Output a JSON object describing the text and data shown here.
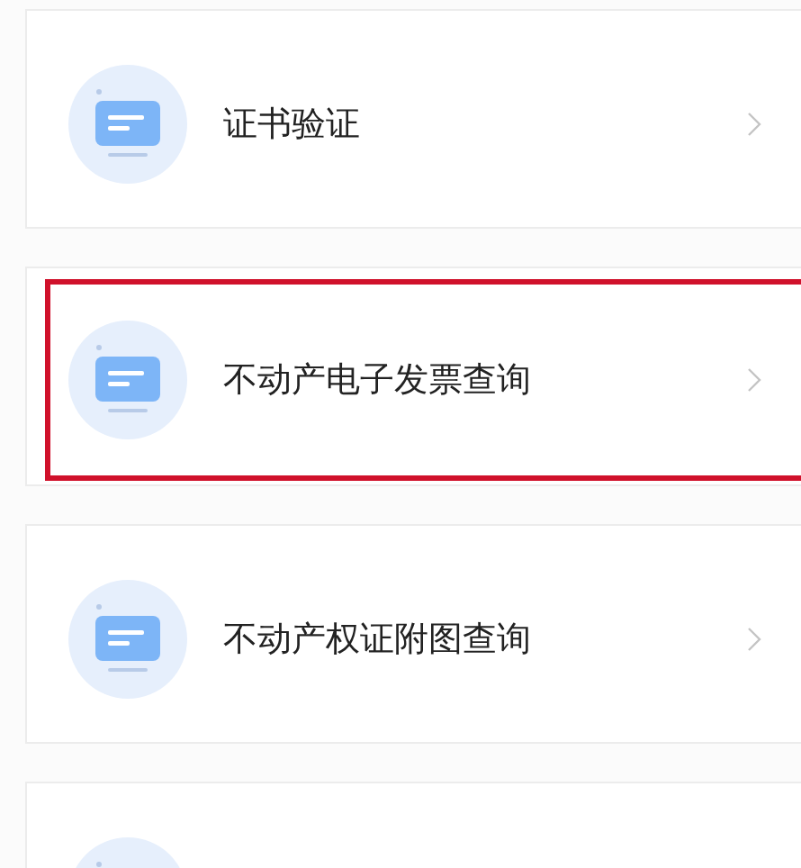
{
  "items": [
    {
      "label": "证书验证",
      "highlighted": false
    },
    {
      "label": "不动产电子发票查询",
      "highlighted": true
    },
    {
      "label": "不动产权证附图查询",
      "highlighted": false
    },
    {
      "highlighted": false
    }
  ]
}
